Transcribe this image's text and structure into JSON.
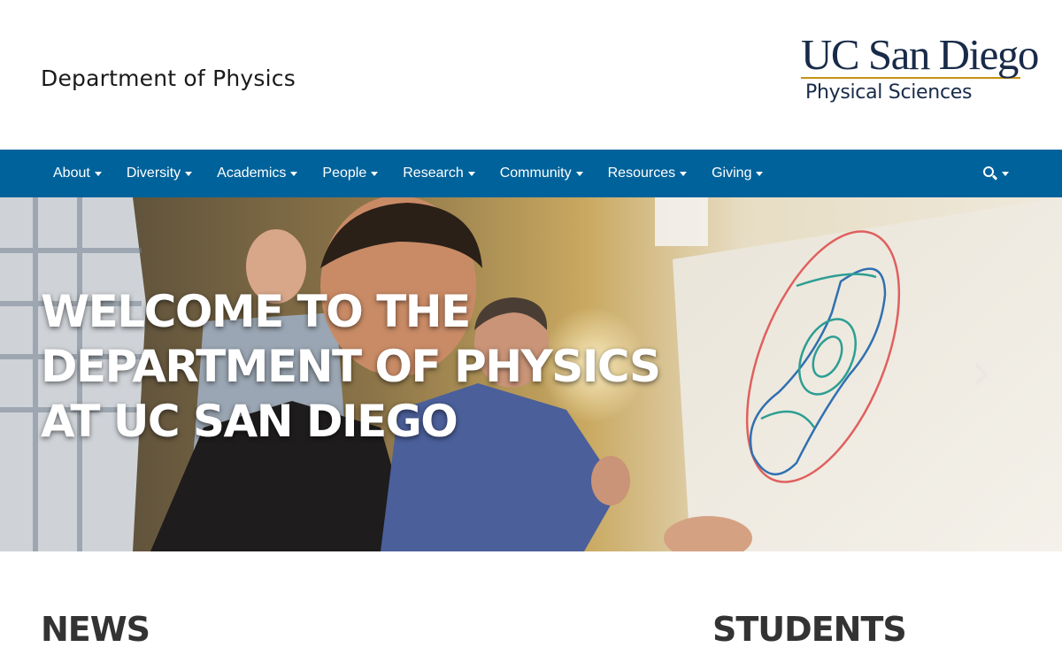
{
  "header": {
    "department_title": "Department of Physics",
    "logo": {
      "wordmark": "UC San Diego",
      "subtitle": "Physical Sciences"
    }
  },
  "nav": {
    "items": [
      {
        "label": "About"
      },
      {
        "label": "Diversity"
      },
      {
        "label": "Academics"
      },
      {
        "label": "People"
      },
      {
        "label": "Research"
      },
      {
        "label": "Community"
      },
      {
        "label": "Resources"
      },
      {
        "label": "Giving"
      }
    ],
    "search_icon": "search-icon"
  },
  "hero": {
    "heading_lines": [
      "WELCOME TO THE",
      "DEPARTMENT OF PHYSICS",
      "AT UC SAN DIEGO"
    ],
    "next_icon": "chevron-right-icon"
  },
  "sections": {
    "news_title": "NEWS",
    "students_title": "STUDENTS"
  },
  "colors": {
    "nav_background": "#00629b",
    "brand_navy": "#182b49",
    "brand_gold": "#c69214",
    "heading_dark": "#333333"
  }
}
